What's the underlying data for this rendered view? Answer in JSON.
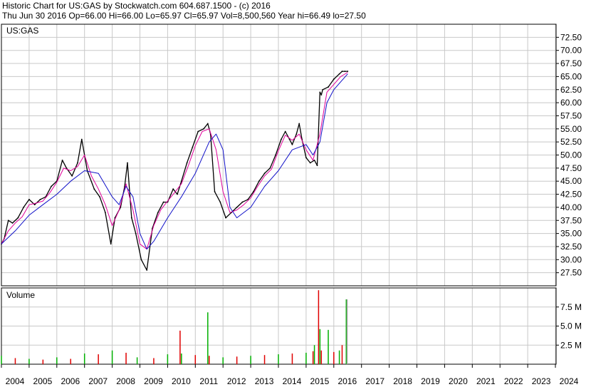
{
  "header": {
    "line1": "Historic Chart for US:GAS by Stockwatch.com 604.687.1500 - (c) 2016",
    "line2": "Thu Jun 30 2016   Op=66.00   Hi=66.00   Lo=65.97   Cl=65.97   Vol=8,500,560   Year hi=66.49   lo=27.50"
  },
  "chart_data": [
    {
      "type": "line",
      "title": "US:GAS",
      "ylim": [
        25.0,
        75.0
      ],
      "y_ticks": [
        "27.50",
        "30.00",
        "32.50",
        "35.00",
        "37.50",
        "40.00",
        "42.50",
        "45.00",
        "47.50",
        "50.00",
        "52.50",
        "55.00",
        "57.50",
        "60.00",
        "62.50",
        "65.00",
        "67.50",
        "70.00",
        "72.50"
      ],
      "x_ticks": [
        "2004",
        "2005",
        "2006",
        "2007",
        "2008",
        "2009",
        "2010",
        "2011",
        "2012",
        "2013",
        "2014",
        "2015",
        "2016",
        "2017",
        "2018",
        "2019",
        "2020",
        "2021",
        "2022",
        "2023",
        "2024"
      ],
      "colors": {
        "price": "#000000",
        "ma_fast": "#e0009a",
        "ma_slow": "#1010c8",
        "grid": "#c8c8c8"
      },
      "series": [
        {
          "x": [
            2004.0,
            2004.1,
            2004.25,
            2004.4,
            2004.6,
            2004.8,
            2005.0,
            2005.2,
            2005.4,
            2005.6,
            2005.8,
            2006.0,
            2006.2,
            2006.35,
            2006.55,
            2006.75,
            2006.9,
            2007.1,
            2007.35,
            2007.55,
            2007.75,
            2007.95,
            2008.1,
            2008.3,
            2008.45,
            2008.55,
            2008.7,
            2008.85,
            2009.05,
            2009.25,
            2009.45,
            2009.65,
            2009.85,
            2010.0,
            2010.2,
            2010.35,
            2010.5,
            2010.7,
            2010.9,
            2011.1,
            2011.3,
            2011.45,
            2011.5,
            2011.55,
            2011.7,
            2011.9,
            2012.1,
            2012.3,
            2012.5,
            2012.7,
            2012.9,
            2013.1,
            2013.3,
            2013.5,
            2013.7,
            2013.9,
            2014.1,
            2014.25,
            2014.4,
            2014.5,
            2014.65,
            2014.75,
            2014.85,
            2015.0,
            2015.15,
            2015.3,
            2015.4,
            2015.5,
            2015.55,
            2015.6,
            2015.8,
            2016.0,
            2016.2,
            2016.3,
            2016.4,
            2016.5
          ],
          "values": [
            33.0,
            34.0,
            37.5,
            37.0,
            38.0,
            40.0,
            41.5,
            40.5,
            41.5,
            42.0,
            44.0,
            45.0,
            49.0,
            47.5,
            46.0,
            48.5,
            53.0,
            47.0,
            43.5,
            42.0,
            39.0,
            33.0,
            38.0,
            40.0,
            44.0,
            48.5,
            38.0,
            35.0,
            30.0,
            28.0,
            36.0,
            39.0,
            41.0,
            41.0,
            43.5,
            42.5,
            45.0,
            48.5,
            51.5,
            54.5,
            55.0,
            56.0,
            55.0,
            54.0,
            43.0,
            41.0,
            38.0,
            39.0,
            40.0,
            41.0,
            41.5,
            43.0,
            45.0,
            46.5,
            47.5,
            50.0,
            53.0,
            54.5,
            53.0,
            52.0,
            54.0,
            56.0,
            53.0,
            49.5,
            48.5,
            49.0,
            48.0,
            62.0,
            61.5,
            62.5,
            63.0,
            64.5,
            65.5,
            66.0,
            66.0,
            66.0
          ]
        },
        {
          "x": [
            2004.0,
            2004.25,
            2004.5,
            2004.75,
            2005.0,
            2005.25,
            2005.5,
            2005.75,
            2006.0,
            2006.25,
            2006.5,
            2006.75,
            2007.0,
            2007.25,
            2007.5,
            2007.75,
            2008.0,
            2008.25,
            2008.5,
            2008.75,
            2009.0,
            2009.25,
            2009.5,
            2009.75,
            2010.0,
            2010.25,
            2010.5,
            2010.75,
            2011.0,
            2011.25,
            2011.5,
            2011.75,
            2012.0,
            2012.25,
            2012.5,
            2012.75,
            2013.0,
            2013.25,
            2013.5,
            2013.75,
            2014.0,
            2014.25,
            2014.5,
            2014.75,
            2015.0,
            2015.25,
            2015.5,
            2015.75,
            2016.0,
            2016.25,
            2016.5
          ],
          "values": [
            33.0,
            35.5,
            37.0,
            38.2,
            40.5,
            40.8,
            41.2,
            42.8,
            44.8,
            47.5,
            47.0,
            47.8,
            50.0,
            46.0,
            43.5,
            40.5,
            36.5,
            39.5,
            44.5,
            39.5,
            33.0,
            32.0,
            36.5,
            39.5,
            41.2,
            42.8,
            44.5,
            48.0,
            51.8,
            54.5,
            55.0,
            51.0,
            43.0,
            39.0,
            39.5,
            40.5,
            41.8,
            44.0,
            46.0,
            47.3,
            50.8,
            53.8,
            52.8,
            54.0,
            51.0,
            49.0,
            54.0,
            62.0,
            63.5,
            65.0,
            65.8
          ]
        },
        {
          "x": [
            2004.0,
            2004.5,
            2005.0,
            2005.5,
            2006.0,
            2006.5,
            2007.0,
            2007.5,
            2008.0,
            2008.25,
            2008.5,
            2008.75,
            2009.0,
            2009.25,
            2009.5,
            2010.0,
            2010.5,
            2011.0,
            2011.5,
            2011.75,
            2012.0,
            2012.25,
            2012.5,
            2013.0,
            2013.5,
            2014.0,
            2014.5,
            2015.0,
            2015.25,
            2015.5,
            2015.75,
            2016.0,
            2016.5
          ],
          "values": [
            33.0,
            35.5,
            38.5,
            40.5,
            42.5,
            45.0,
            47.0,
            46.5,
            42.0,
            40.5,
            44.0,
            42.0,
            35.0,
            32.0,
            33.5,
            38.0,
            42.0,
            46.5,
            52.5,
            54.0,
            51.0,
            40.0,
            38.0,
            40.0,
            44.0,
            47.0,
            51.0,
            52.0,
            50.0,
            52.5,
            60.0,
            62.5,
            65.5
          ]
        }
      ]
    },
    {
      "type": "bar",
      "title": "Volume",
      "ylim": [
        0,
        10000000
      ],
      "y_ticks": [
        "2.5 M",
        "5.0 M",
        "7.5 M"
      ],
      "colors": {
        "up": "#00b000",
        "down": "#e00000",
        "last": "#a0a0a0"
      },
      "x": [
        2004.0,
        2004.5,
        2005.0,
        2005.5,
        2006.0,
        2006.5,
        2007.0,
        2007.5,
        2008.0,
        2008.5,
        2008.9,
        2009.5,
        2010.0,
        2010.45,
        2010.5,
        2011.0,
        2011.45,
        2011.5,
        2012.0,
        2012.5,
        2013.0,
        2013.5,
        2014.0,
        2014.5,
        2015.0,
        2015.25,
        2015.3,
        2015.45,
        2015.5,
        2015.55,
        2015.8,
        2016.0,
        2016.2,
        2016.3,
        2016.45,
        2016.48
      ],
      "values": [
        1100000,
        800000,
        700000,
        600000,
        900000,
        700000,
        1400000,
        1300000,
        1800000,
        1500000,
        900000,
        800000,
        1300000,
        4400000,
        1400000,
        1200000,
        6800000,
        1100000,
        900000,
        1000000,
        1100000,
        1200000,
        1300000,
        1400000,
        1500000,
        1700000,
        2500000,
        9700000,
        4600000,
        1800000,
        4500000,
        1600000,
        1800000,
        2500000,
        8500000,
        8500000
      ]
    }
  ]
}
